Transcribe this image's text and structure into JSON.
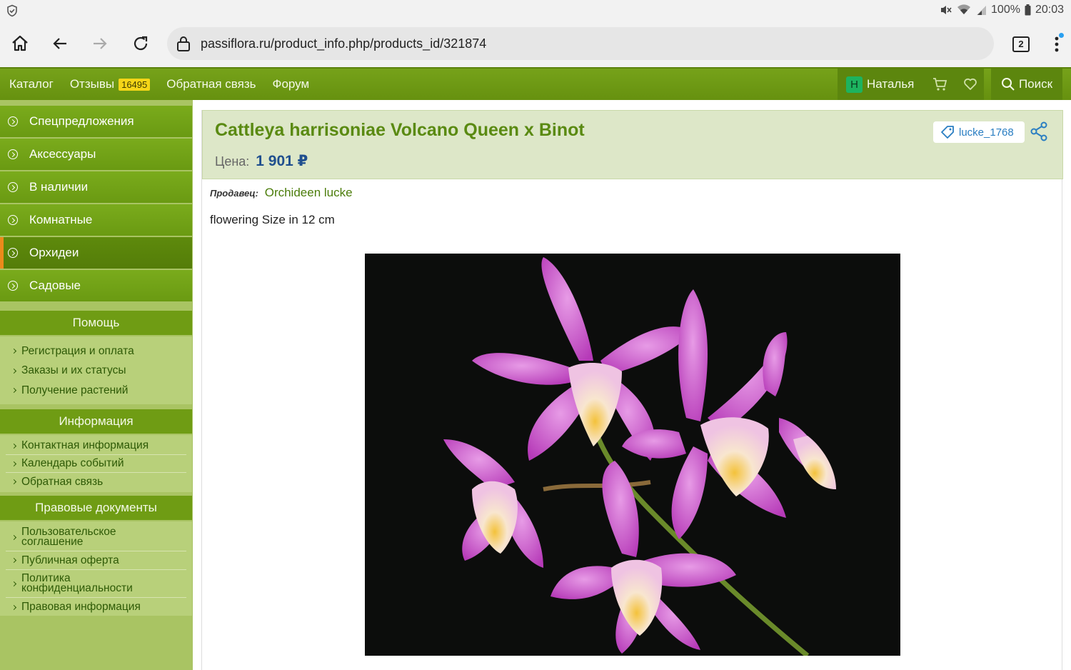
{
  "status_bar": {
    "battery": "100%",
    "time": "20:03"
  },
  "browser": {
    "url": "passiflora.ru/product_info.php/products_id/321874",
    "tab_count": "2"
  },
  "nav": {
    "items": [
      {
        "label": "Каталог"
      },
      {
        "label": "Отзывы",
        "count": "16495"
      },
      {
        "label": "Обратная связь"
      },
      {
        "label": "Форум"
      }
    ],
    "user_initial": "Н",
    "user_name": "Наталья",
    "search_label": "Поиск"
  },
  "sidebar": {
    "categories": [
      {
        "label": "Спецпредложения"
      },
      {
        "label": "Аксессуары"
      },
      {
        "label": "В наличии"
      },
      {
        "label": "Комнатные"
      },
      {
        "label": "Орхидеи"
      },
      {
        "label": "Садовые"
      }
    ],
    "help": {
      "title": "Помощь",
      "links": [
        "Регистрация и оплата",
        "Заказы и их статусы",
        "Получение растений"
      ]
    },
    "info": {
      "title": "Информация",
      "links": [
        "Контактная информация",
        "Календарь событий",
        "Обратная связь"
      ]
    },
    "legal": {
      "title": "Правовые документы",
      "links": [
        {
          "line1": "Пользовательское",
          "line2": "соглашение"
        },
        {
          "line1": "Публичная оферта",
          "line2": ""
        },
        {
          "line1": "Политика",
          "line2": "конфиденциальности"
        },
        {
          "line1": "Правовая информация",
          "line2": ""
        }
      ]
    }
  },
  "product": {
    "title": "Cattleya harrisoniae Volcano Queen x Binot",
    "price_label": "Цена:",
    "price": "1 901 ₽",
    "tag": "lucke_1768",
    "seller_label": "Продавец:",
    "seller": "Orchideen lucke",
    "description": "flowering Size in 12 cm"
  },
  "colors": {
    "header_green": "#6f9c14",
    "sidebar_bg": "#a9c463",
    "active_marker": "#ec8a1b",
    "title_green": "#5a8a12",
    "price_blue": "#1f4f8e",
    "tag_blue": "#2a7ec2"
  }
}
